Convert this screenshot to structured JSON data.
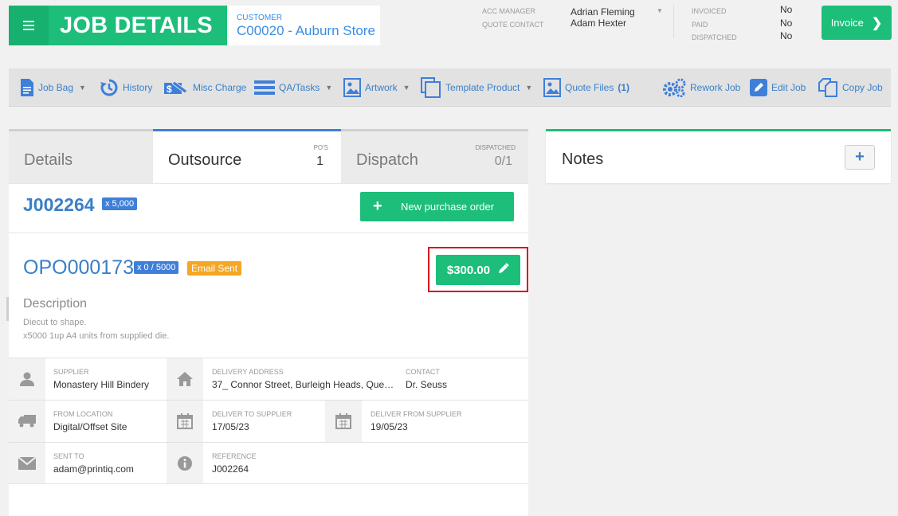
{
  "header": {
    "title": "JOB DETAILS",
    "customer_label": "CUSTOMER",
    "customer_value": "C00020 - Auburn Store",
    "acc_manager_label": "ACC MANAGER",
    "acc_manager_value": "Adrian Fleming",
    "quote_contact_label": "QUOTE CONTACT",
    "quote_contact_value": "Adam Hexter",
    "invoiced_label": "INVOICED",
    "invoiced_value": "No",
    "paid_label": "PAID",
    "paid_value": "No",
    "dispatched_label": "DISPATCHED",
    "dispatched_value": "No",
    "invoice_button": "Invoice"
  },
  "toolbar": [
    {
      "label": "Job Bag",
      "icon": "document-icon",
      "caret": true
    },
    {
      "label": "History",
      "icon": "history-icon",
      "caret": false
    },
    {
      "label": "Misc Charge",
      "icon": "misc-charge-icon",
      "caret": false
    },
    {
      "label": "QA/Tasks",
      "icon": "tasks-icon",
      "caret": true
    },
    {
      "label": "Artwork",
      "icon": "image-icon",
      "caret": true
    },
    {
      "label": "Template Product",
      "icon": "template-icon",
      "caret": true
    },
    {
      "label": "Quote Files",
      "count": "(1)",
      "icon": "image-icon",
      "caret": false
    },
    {
      "label": "Rework Job",
      "icon": "gears-icon",
      "caret": false
    },
    {
      "label": "Edit Job",
      "icon": "edit-icon",
      "caret": false
    },
    {
      "label": "Copy Job",
      "icon": "copy-icon",
      "caret": false
    }
  ],
  "tabs": {
    "details": "Details",
    "outsource": "Outsource",
    "pos_label": "PO'S",
    "pos_value": "1",
    "dispatch": "Dispatch",
    "dispatched_label": "DISPATCHED",
    "dispatched_value": "0/1"
  },
  "job": {
    "number": "J002264",
    "qty": "x 5,000",
    "new_po_button": "New purchase order"
  },
  "po": {
    "number": "OPO000173",
    "qty": "x 0 / 5000",
    "status": "Email Sent",
    "price": "$300.00",
    "description_heading": "Description",
    "description_lines": [
      "Diecut to shape.",
      "x5000 1up A4 units from supplied die."
    ]
  },
  "info": {
    "supplier_label": "SUPPLIER",
    "supplier_value": "Monastery Hill Bindery",
    "delivery_address_label": "DELIVERY ADDRESS",
    "delivery_address_value": "37_ Connor Street, Burleigh Heads, Que…",
    "contact_label": "CONTACT",
    "contact_value": "Dr. Seuss",
    "from_location_label": "FROM LOCATION",
    "from_location_value": "Digital/Offset Site",
    "deliver_to_supplier_label": "DELIVER TO SUPPLIER",
    "deliver_to_supplier_value": "17/05/23",
    "deliver_from_supplier_label": "DELIVER FROM SUPPLIER",
    "deliver_from_supplier_value": "19/05/23",
    "sent_to_label": "SENT TO",
    "sent_to_value": "adam@printiq.com",
    "reference_label": "REFERENCE",
    "reference_value": "J002264"
  },
  "notes": {
    "title": "Notes",
    "add_symbol": "+"
  },
  "colors": {
    "accent_green": "#1cbe7a",
    "accent_blue": "#3f7fd9",
    "status_orange": "#f5a623",
    "highlight_red": "#d9141c"
  }
}
